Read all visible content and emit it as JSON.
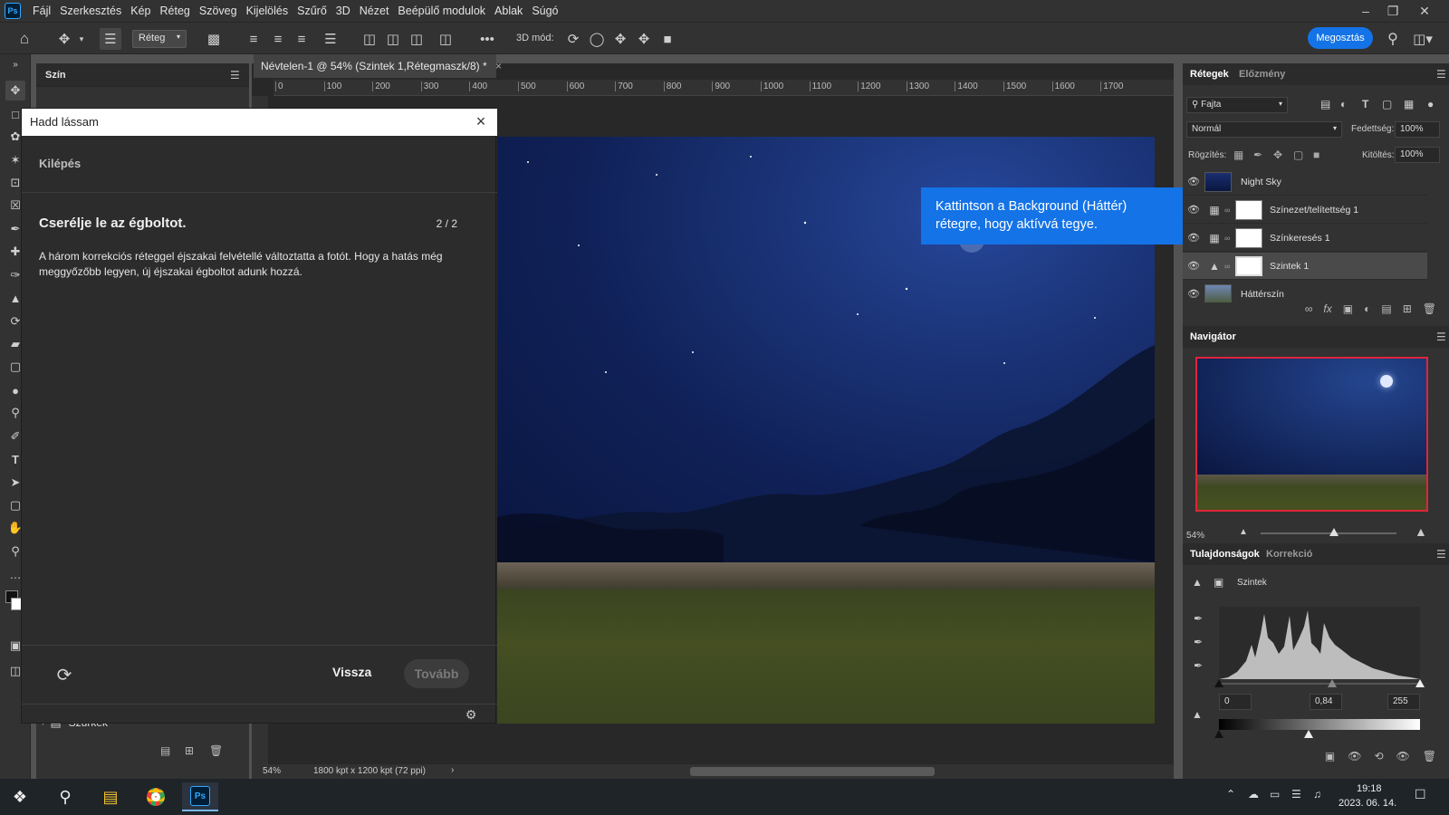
{
  "app": {
    "logo": "Ps"
  },
  "menu": [
    "Fájl",
    "Szerkesztés",
    "Kép",
    "Réteg",
    "Szöveg",
    "Kijelölés",
    "Szűrő",
    "3D",
    "Nézet",
    "Beépülő modulok",
    "Ablak",
    "Súgó"
  ],
  "options_bar": {
    "layer_select": "Réteg",
    "mode_3d_label": "3D mód:",
    "share_label": "Megosztás"
  },
  "left_panel": {
    "tab_label": "Szín",
    "folder_label": "Szürkék"
  },
  "document": {
    "tab_title": "Névtelen-1 @ 54% (Szintek 1,Rétegmaszk/8) *",
    "ruler_ticks": [
      "0",
      "100",
      "200",
      "300",
      "400",
      "500",
      "600",
      "700",
      "800",
      "900",
      "1000",
      "1100",
      "1200",
      "1300",
      "1400",
      "1500",
      "1600",
      "1700"
    ],
    "status_zoom": "54%",
    "status_info": "1800 kpt x 1200 kpt (72 ppi)"
  },
  "dialog": {
    "title": "Hadd lássam",
    "exit_label": "Kilépés",
    "heading": "Cserélje le az égboltot.",
    "step": "2 / 2",
    "body": "A három korrekciós réteggel éjszakai felvétellé változtatta a fotót. Hogy a hatás még meggyőzőbb legyen, új éjszakai égboltot adunk hozzá.",
    "back_label": "Vissza",
    "next_label": "Tovább"
  },
  "callout": {
    "text": "Kattintson a Background (Háttér) rétegre, hogy aktívvá tegye."
  },
  "layers_panel": {
    "tabs": [
      "Rétegek",
      "Előzmény"
    ],
    "filter_label": "Fajta",
    "blend_mode": "Normál",
    "opacity_label": "Fedettség:",
    "opacity_value": "100%",
    "lock_label": "Rögzítés:",
    "fill_label": "Kitöltés:",
    "fill_value": "100%",
    "layers": [
      {
        "name": "Night Sky",
        "selected": false
      },
      {
        "name": "Színezet/telítettség 1",
        "selected": false
      },
      {
        "name": "Színkeresés 1",
        "selected": false
      },
      {
        "name": "Szintek 1",
        "selected": true
      },
      {
        "name": "Háttérszín",
        "selected": false
      }
    ]
  },
  "navigator": {
    "title": "Navigátor",
    "zoom": "54%",
    "zoom_slider_fraction": 0.54
  },
  "properties": {
    "tabs": [
      "Tulajdonságok",
      "Korrekció"
    ],
    "adjustment_label": "Szintek",
    "input_black": "0",
    "input_gamma": "0,84",
    "input_white": "255"
  },
  "taskbar": {
    "time": "19:18",
    "date": "2023. 06. 14."
  },
  "colors": {
    "accent": "#1473e6",
    "panel": "#323232",
    "canvas_bg": "#282828",
    "sky": "#102158"
  }
}
